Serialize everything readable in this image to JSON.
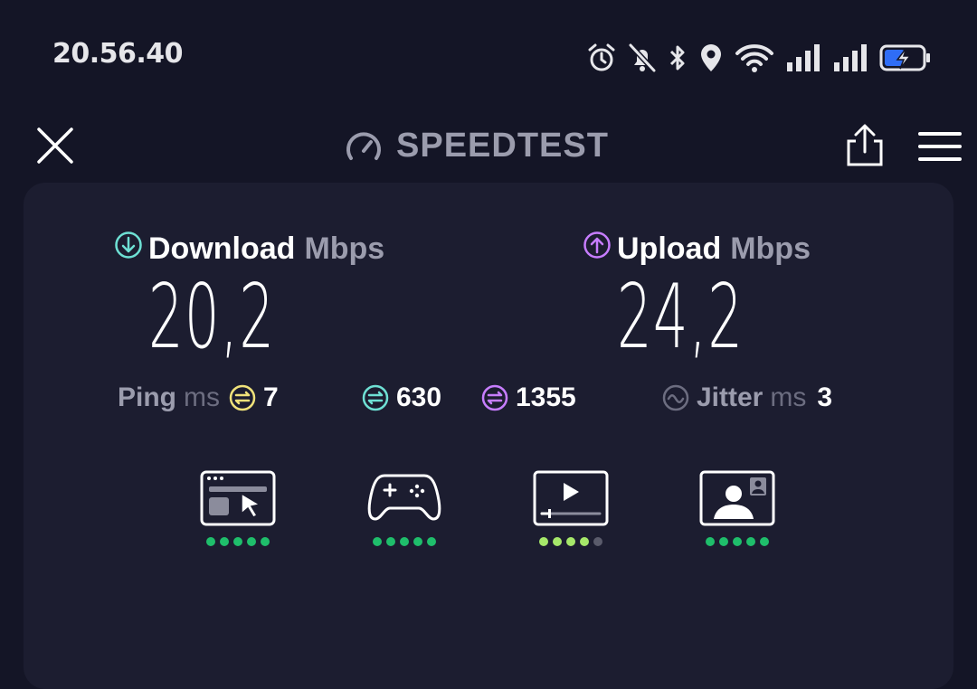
{
  "status": {
    "time": "20.56.40"
  },
  "header": {
    "title": "SPEEDTEST"
  },
  "download": {
    "label": "Download",
    "unit": "Mbps",
    "value": "20,2"
  },
  "upload": {
    "label": "Upload",
    "unit": "Mbps",
    "value": "24,2"
  },
  "ping": {
    "label": "Ping",
    "unit": "ms",
    "idle": "7",
    "download": "630",
    "upload": "1355"
  },
  "jitter": {
    "label": "Jitter",
    "unit": "ms",
    "value": "3"
  },
  "usecases": [
    {
      "icon": "web-browsing-icon",
      "rating": 5
    },
    {
      "icon": "gaming-icon",
      "rating": 5
    },
    {
      "icon": "video-streaming-icon",
      "rating": 4
    },
    {
      "icon": "video-call-icon",
      "rating": 5
    }
  ],
  "colors": {
    "background": "#141526",
    "card": "#1c1d30",
    "download_accent": "#6ee0d4",
    "upload_accent": "#c77dff",
    "ping_idle": "#f0e27a",
    "rating_full": "#1fbe6b",
    "rating_light": "#a6e86a",
    "rating_off": "#5a5b6b"
  }
}
